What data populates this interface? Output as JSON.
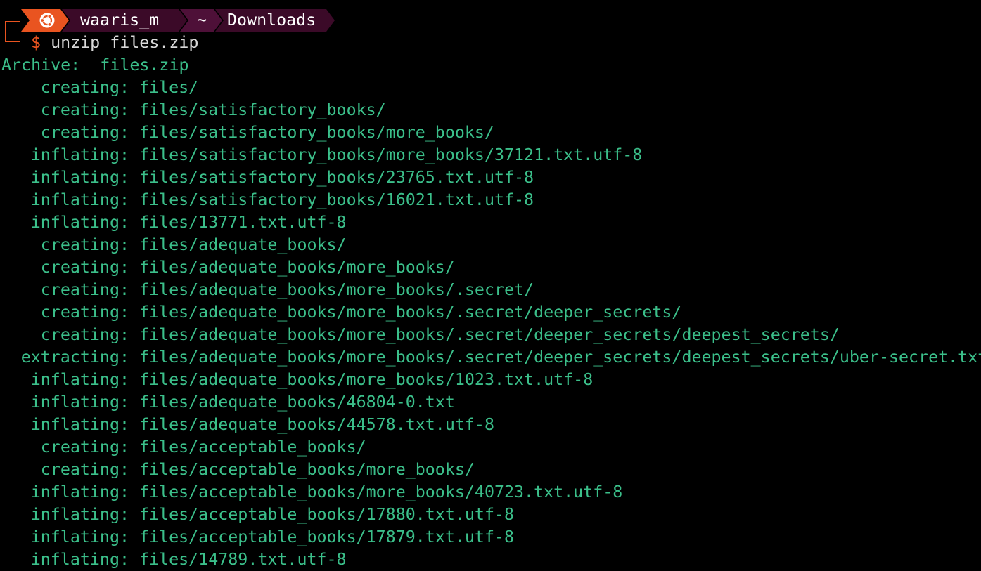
{
  "prompt": {
    "os_icon": "ubuntu-icon",
    "user": "waaris_m",
    "home": "~",
    "directory": "Downloads",
    "symbol": "$",
    "command": "unzip files.zip"
  },
  "colors": {
    "accent": "#e95420",
    "segment_dark": "#3b0a28",
    "output_text": "#3bbf8a",
    "command_text": "#d9d9d9",
    "background": "#000000"
  },
  "output": {
    "archive_label": "Archive:",
    "archive_name": "files.zip",
    "lines": [
      {
        "action": "creating:",
        "path": "files/"
      },
      {
        "action": "creating:",
        "path": "files/satisfactory_books/"
      },
      {
        "action": "creating:",
        "path": "files/satisfactory_books/more_books/"
      },
      {
        "action": "inflating:",
        "path": "files/satisfactory_books/more_books/37121.txt.utf-8"
      },
      {
        "action": "inflating:",
        "path": "files/satisfactory_books/23765.txt.utf-8"
      },
      {
        "action": "inflating:",
        "path": "files/satisfactory_books/16021.txt.utf-8"
      },
      {
        "action": "inflating:",
        "path": "files/13771.txt.utf-8"
      },
      {
        "action": "creating:",
        "path": "files/adequate_books/"
      },
      {
        "action": "creating:",
        "path": "files/adequate_books/more_books/"
      },
      {
        "action": "creating:",
        "path": "files/adequate_books/more_books/.secret/"
      },
      {
        "action": "creating:",
        "path": "files/adequate_books/more_books/.secret/deeper_secrets/"
      },
      {
        "action": "creating:",
        "path": "files/adequate_books/more_books/.secret/deeper_secrets/deepest_secrets/"
      },
      {
        "action": "extracting:",
        "path": "files/adequate_books/more_books/.secret/deeper_secrets/deepest_secrets/uber-secret.txt"
      },
      {
        "action": "inflating:",
        "path": "files/adequate_books/more_books/1023.txt.utf-8"
      },
      {
        "action": "inflating:",
        "path": "files/adequate_books/46804-0.txt"
      },
      {
        "action": "inflating:",
        "path": "files/adequate_books/44578.txt.utf-8"
      },
      {
        "action": "creating:",
        "path": "files/acceptable_books/"
      },
      {
        "action": "creating:",
        "path": "files/acceptable_books/more_books/"
      },
      {
        "action": "inflating:",
        "path": "files/acceptable_books/more_books/40723.txt.utf-8"
      },
      {
        "action": "inflating:",
        "path": "files/acceptable_books/17880.txt.utf-8"
      },
      {
        "action": "inflating:",
        "path": "files/acceptable_books/17879.txt.utf-8"
      },
      {
        "action": "inflating:",
        "path": "files/14789.txt.utf-8"
      }
    ]
  }
}
